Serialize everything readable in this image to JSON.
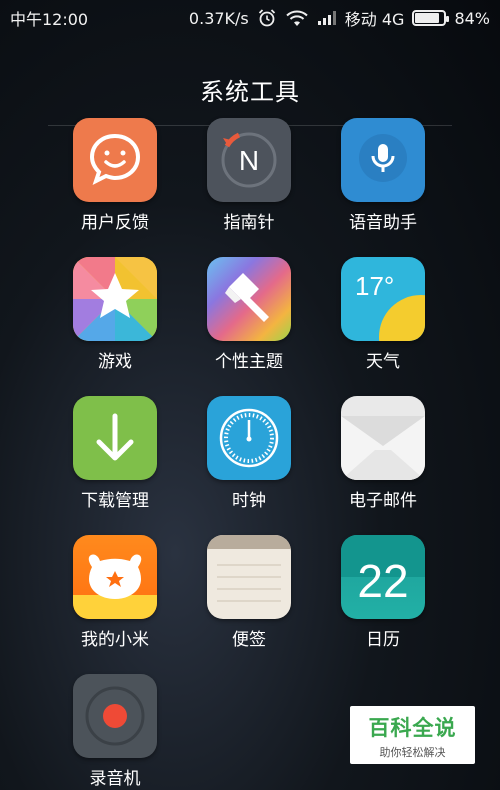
{
  "status": {
    "time": "中午12:00",
    "speed": "0.37K/s",
    "carrier": "移动 4G",
    "battery": "84%",
    "battery_level": 0.84
  },
  "folder": {
    "title": "系统工具"
  },
  "apps": [
    {
      "label": "用户反馈",
      "icon": "feedback-smile-icon"
    },
    {
      "label": "指南针",
      "icon": "compass-icon"
    },
    {
      "label": "语音助手",
      "icon": "microphone-icon"
    },
    {
      "label": "游戏",
      "icon": "game-star-icon"
    },
    {
      "label": "个性主题",
      "icon": "theme-brush-icon"
    },
    {
      "label": "天气",
      "icon": "weather-sun-icon",
      "temperature": "17°"
    },
    {
      "label": "下载管理",
      "icon": "download-arrow-icon"
    },
    {
      "label": "时钟",
      "icon": "clock-icon"
    },
    {
      "label": "电子邮件",
      "icon": "mail-envelope-icon"
    },
    {
      "label": "我的小米",
      "icon": "mi-bunny-icon"
    },
    {
      "label": "便签",
      "icon": "notes-icon"
    },
    {
      "label": "日历",
      "icon": "calendar-icon",
      "day": "22"
    },
    {
      "label": "录音机",
      "icon": "recorder-icon"
    }
  ],
  "watermark": {
    "title": "百科全说",
    "subtitle": "助你轻松解决"
  }
}
